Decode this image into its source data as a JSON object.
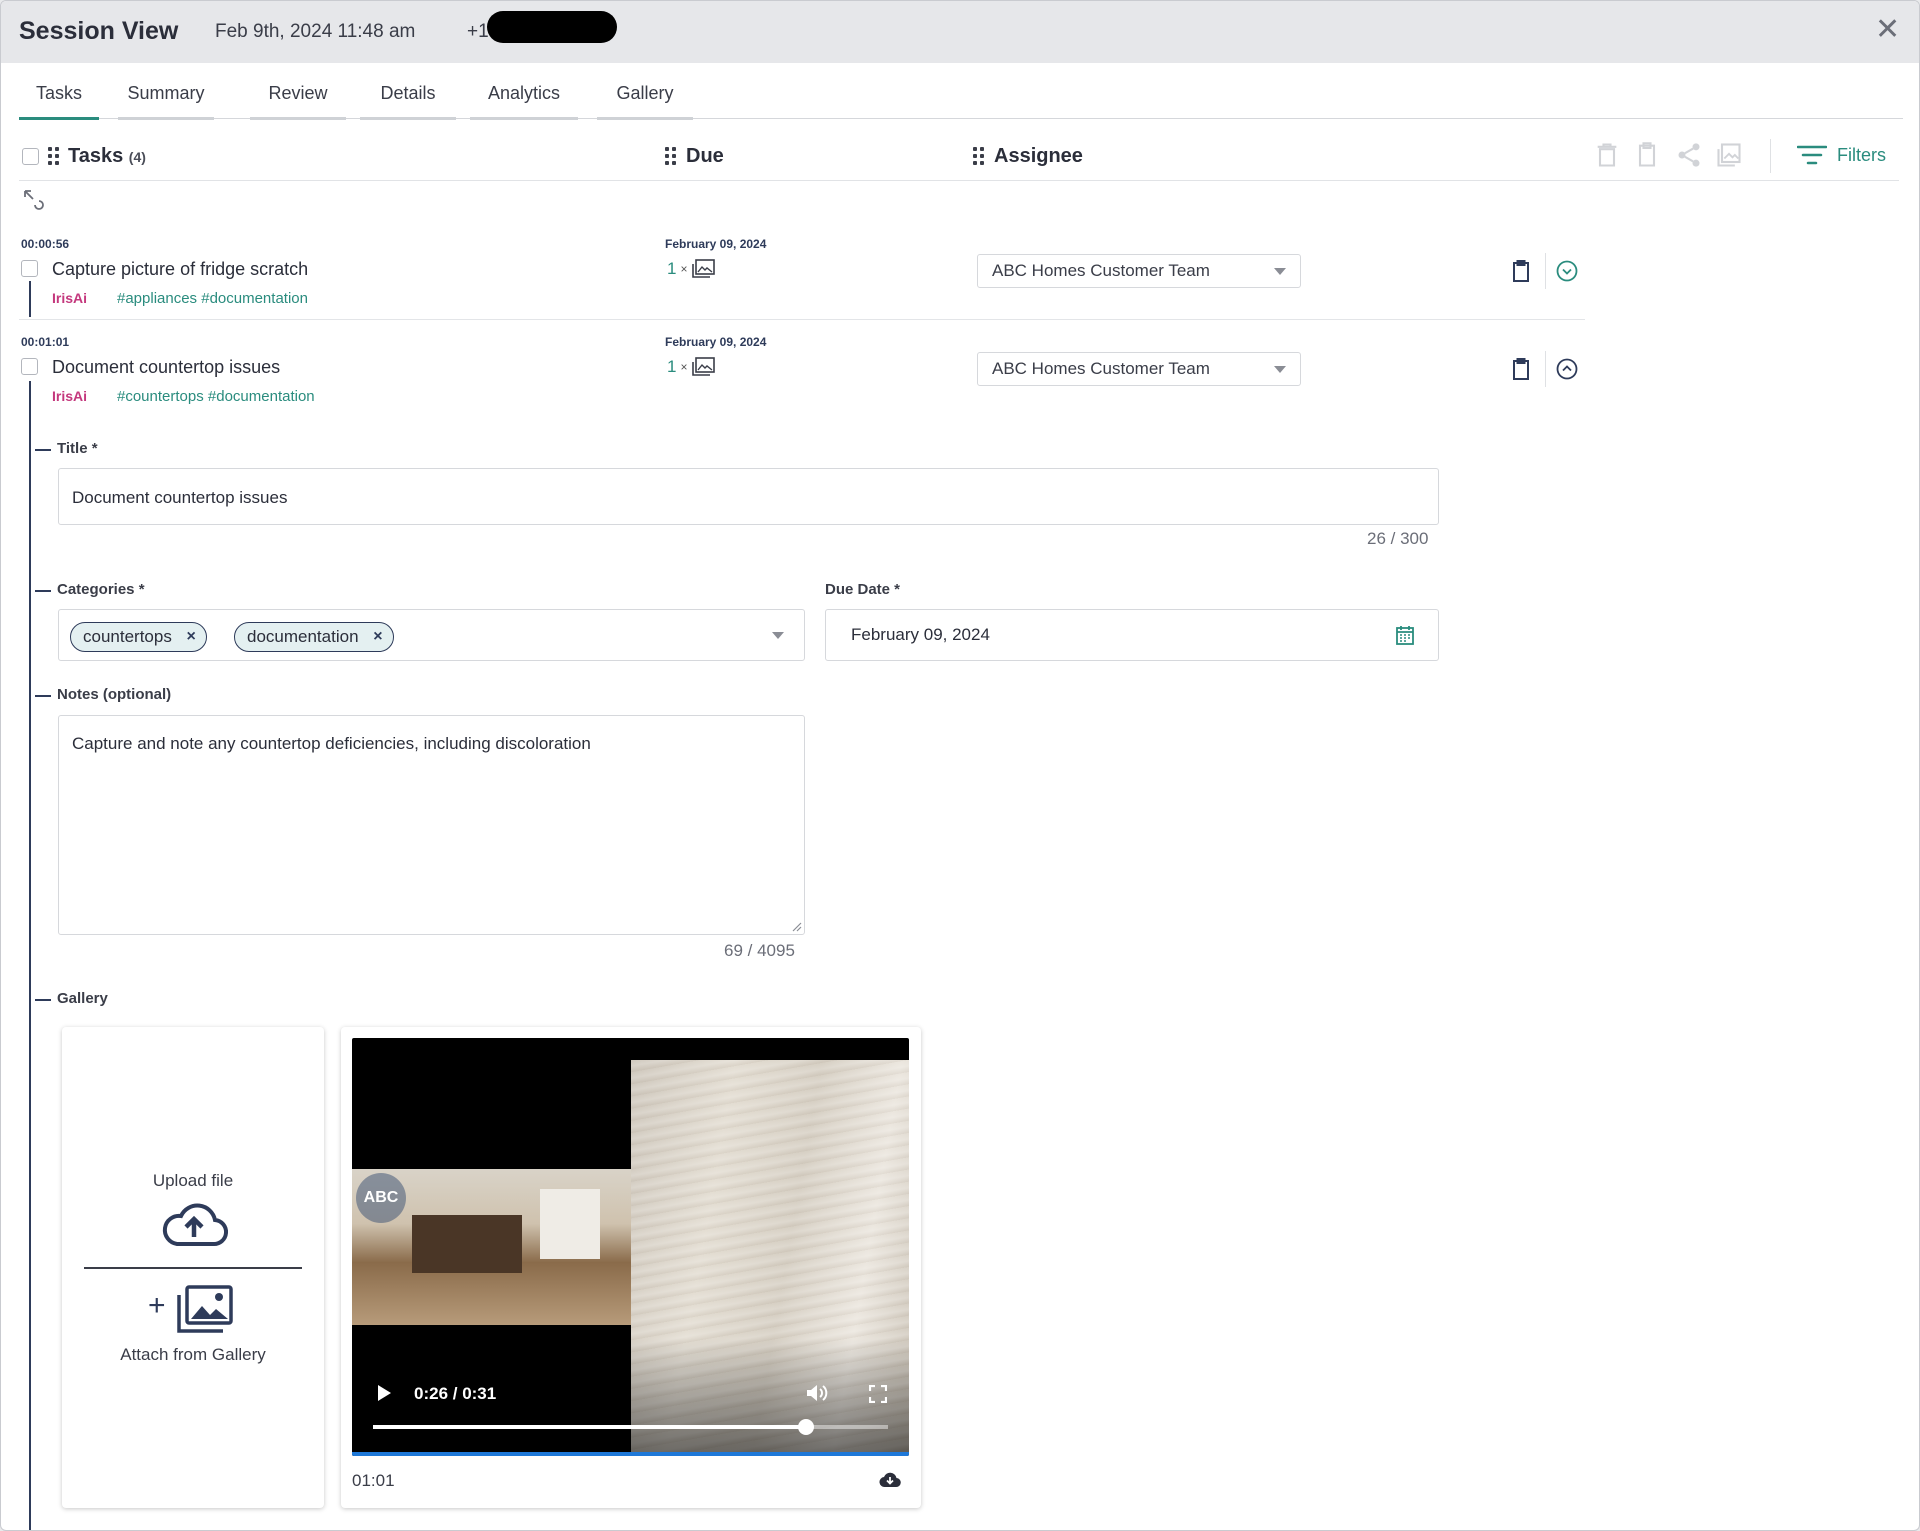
{
  "header": {
    "title": "Session View",
    "datetime": "Feb 9th, 2024 11:48 am",
    "phone_prefix": "+1",
    "close_icon": "close-icon"
  },
  "tabs": [
    {
      "label": "Tasks",
      "active": true
    },
    {
      "label": "Summary"
    },
    {
      "label": "Review"
    },
    {
      "label": "Details"
    },
    {
      "label": "Analytics"
    },
    {
      "label": "Gallery"
    }
  ],
  "table": {
    "col_tasks": "Tasks",
    "task_count": "(4)",
    "col_due": "Due",
    "col_assignee": "Assignee",
    "filters_label": "Filters"
  },
  "tasks": [
    {
      "time": "00:00:56",
      "title": "Capture picture of fridge scratch",
      "owner": "IrisAi",
      "tags": "#appliances  #documentation",
      "due": "February 09, 2024",
      "media_count": "1",
      "media_x": "×",
      "assignee": "ABC Homes Customer Team",
      "expanded": false
    },
    {
      "time": "00:01:01",
      "title": "Document countertop issues",
      "owner": "IrisAi",
      "tags": "#countertops  #documentation",
      "due": "February 09, 2024",
      "media_count": "1",
      "media_x": "×",
      "assignee": "ABC Homes Customer Team",
      "expanded": true
    }
  ],
  "form": {
    "title_label": "Title *",
    "title_value": "Document countertop issues",
    "title_counter": "26 / 300",
    "categories_label": "Categories *",
    "categories": [
      "countertops",
      "documentation"
    ],
    "chip_remove": "×",
    "due_date_label": "Due Date *",
    "due_date_value": "February 09, 2024",
    "notes_label": "Notes (optional)",
    "notes_value": "Capture and note any countertop deficiencies, including discoloration",
    "notes_counter": "69 / 4095",
    "gallery_label": "Gallery"
  },
  "gallery": {
    "upload_label": "Upload file",
    "attach_label": "Attach from Gallery",
    "video": {
      "time_display": "0:26 / 0:31",
      "progress_fraction": 0.84,
      "caption": "01:01"
    }
  },
  "colors": {
    "accent": "#2a8c7e",
    "owner": "#c4387d",
    "navy": "#2e3b5a"
  }
}
